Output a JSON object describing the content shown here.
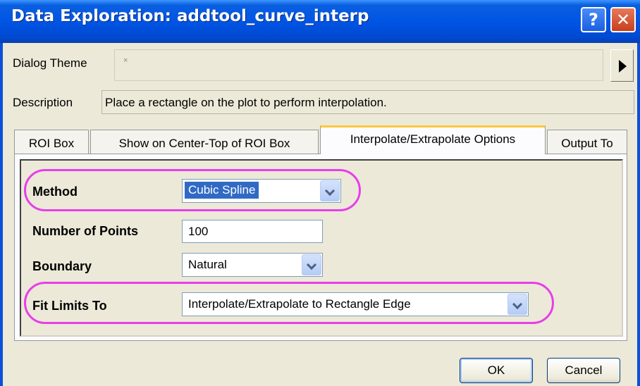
{
  "window": {
    "title": "Data Exploration: addtool_curve_interp",
    "help_label": "?",
    "close_label": "✕"
  },
  "dialog_theme": {
    "label": "Dialog Theme",
    "value_placeholder": "×"
  },
  "description": {
    "label": "Description",
    "text": "Place a rectangle on the plot to perform interpolation."
  },
  "tabs": [
    {
      "label": "ROI Box",
      "active": false
    },
    {
      "label": "Show on Center-Top of ROI Box",
      "active": false
    },
    {
      "label": "Interpolate/Extrapolate Options",
      "active": true
    },
    {
      "label": "Output To",
      "active": false
    }
  ],
  "options": {
    "method": {
      "label": "Method",
      "value": "Cubic Spline"
    },
    "number_of_points": {
      "label": "Number of Points",
      "value": "100"
    },
    "boundary": {
      "label": "Boundary",
      "value": "Natural"
    },
    "fit_limits_to": {
      "label": "Fit Limits To",
      "value": "Interpolate/Extrapolate to Rectangle Edge"
    }
  },
  "buttons": {
    "ok": "OK",
    "cancel": "Cancel"
  },
  "colors": {
    "titlebar": "#0055e5",
    "highlight": "#e83ee8",
    "selection": "#316ac5",
    "face": "#ece9d8"
  }
}
